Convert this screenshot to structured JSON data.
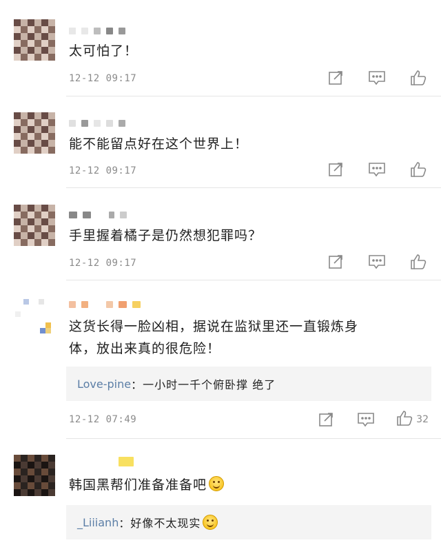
{
  "comments": [
    {
      "text": "太可怕了！",
      "time": "12-12  09:17",
      "likes": ""
    },
    {
      "text": "能不能留点好在这个世界上！",
      "time": "12-12  09:17",
      "likes": ""
    },
    {
      "text": "手里握着橘子是仍然想犯罪吗？",
      "time": "12-12  09:17",
      "likes": ""
    },
    {
      "text_line1": "这货长得一脸凶相，据说在监狱里还一直锻炼身",
      "text_line2": "体，放出来真的很危险！",
      "reply_name": "Love-pine",
      "reply_sep": "：",
      "reply_text": "一小时一千个俯卧撑  绝了",
      "time": "12-12  07:49",
      "likes": "32"
    },
    {
      "text": "韩国黑帮们准备准备吧",
      "reply_name": "_Liiianh",
      "reply_sep": "：",
      "reply_text": "好像不太现实"
    }
  ],
  "icons": {
    "share": "share-icon",
    "comment": "comment-icon",
    "like": "thumbs-up-icon"
  }
}
